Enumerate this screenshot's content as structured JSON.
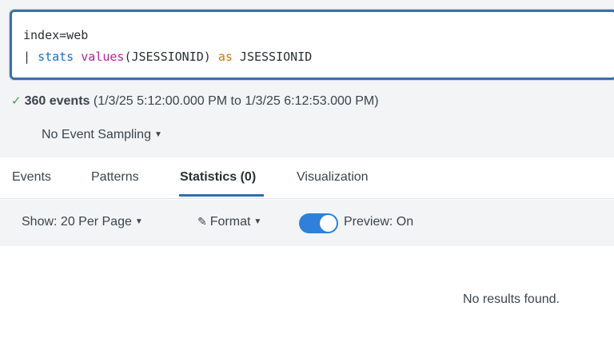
{
  "search": {
    "line1": "index=web",
    "line2_pipe": "| ",
    "line2_cmd": "stats",
    "line2_fn": "values",
    "line2_arg": "(JSESSIONID) ",
    "line2_as": "as",
    "line2_field": " JSESSIONID"
  },
  "status": {
    "check": "✓",
    "count": "360 events",
    "range": " (1/3/25 5:12:00.000 PM to 1/3/25 6:12:53.000 PM)"
  },
  "sampling": {
    "label": "No Event Sampling",
    "caret": "▼"
  },
  "tabs": [
    {
      "label": "Events"
    },
    {
      "label": "Patterns"
    },
    {
      "label": "Statistics (0)"
    },
    {
      "label": "Visualization"
    }
  ],
  "toolbar": {
    "show_label": "Show: 20 Per Page",
    "format_label": "Format",
    "caret": "▼",
    "pencil": "✎",
    "preview_label": "Preview: On"
  },
  "results": {
    "empty_message": "No results found."
  },
  "colors": {
    "accent": "#2f6fb0",
    "toggle_on": "#2f80d8",
    "check": "#4a9e4a"
  }
}
